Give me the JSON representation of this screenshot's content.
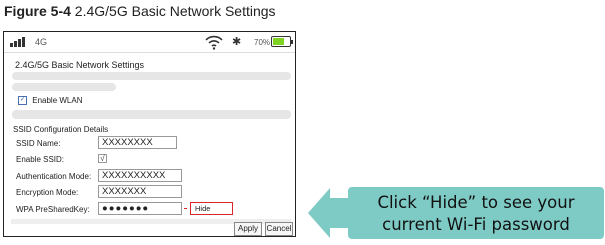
{
  "caption": {
    "label": "Figure 5-4",
    "text": "2.4G/5G Basic Network Settings"
  },
  "status_bar": {
    "network_type": "4G",
    "battery_percent": "70%",
    "battery_level": 0.7,
    "icons": [
      "signal-icon",
      "wifi-icon",
      "bluetooth-icon",
      "battery-icon"
    ],
    "battery_color": "#7ed321"
  },
  "page": {
    "title": "2.4G/5G Basic Network Settings",
    "enable_wlan_label": "Enable WLAN",
    "enable_wlan_mark": "✓"
  },
  "ssid_config": {
    "section_title": "SSID Configuration Details",
    "rows": {
      "ssid_name": {
        "label": "SSID Name:",
        "value": "XXXXXXXX"
      },
      "enable_ssid": {
        "label": "Enable SSID:",
        "value": "√"
      },
      "authentication_mode": {
        "label": "Authentication Mode:",
        "value": "XXXXXXXXXX"
      },
      "encryption_mode": {
        "label": "Encryption Mode:",
        "value": "XXXXXXX"
      },
      "wpa_key": {
        "label": "WPA PreSharedKey:",
        "value": "●●●●●●●",
        "toggle": "Hide"
      }
    }
  },
  "buttons": {
    "apply": "Apply",
    "cancel": "Cancel"
  },
  "callout": {
    "line1": "Click “Hide” to see your",
    "line2": "current Wi-Fi password",
    "fill_color": "#7ecbc6",
    "highlight_color": "#d9262b"
  }
}
